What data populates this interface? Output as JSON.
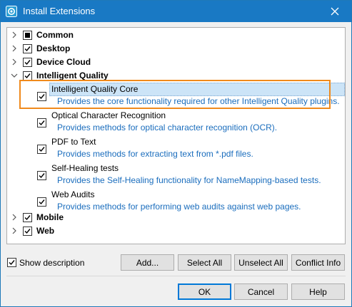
{
  "window": {
    "title": "Install Extensions",
    "app_icon": "extensions-app-icon",
    "close_icon": "close-icon"
  },
  "tree": {
    "groups": [
      {
        "label": "Common",
        "expanded": false,
        "state": "partial"
      },
      {
        "label": "Desktop",
        "expanded": false,
        "state": "checked"
      },
      {
        "label": "Device Cloud",
        "expanded": false,
        "state": "checked"
      },
      {
        "label": "Intelligent Quality",
        "expanded": true,
        "state": "checked"
      },
      {
        "label": "Mobile",
        "expanded": false,
        "state": "checked"
      },
      {
        "label": "Web",
        "expanded": false,
        "state": "checked"
      }
    ],
    "items": [
      {
        "title": "Intelligent Quality Core",
        "description": "Provides the core functionality required for other Intelligent Quality plugins.",
        "checked": true,
        "selected": true
      },
      {
        "title": "Optical Character Recognition",
        "description": "Provides methods for optical character recognition (OCR).",
        "checked": true,
        "selected": false
      },
      {
        "title": "PDF to Text",
        "description": "Provides methods for extracting text from *.pdf files.",
        "checked": true,
        "selected": false
      },
      {
        "title": "Self-Healing tests",
        "description": "Provides the Self-Healing functionality for NameMapping-based tests.",
        "checked": true,
        "selected": false
      },
      {
        "title": "Web Audits",
        "description": "Provides methods for performing web audits against web pages.",
        "checked": true,
        "selected": false
      }
    ]
  },
  "options": {
    "show_description_label": "Show description",
    "show_description_checked": true
  },
  "buttons": {
    "add": "Add...",
    "select_all": "Select All",
    "unselect_all": "Unselect All",
    "conflict_info": "Conflict Info",
    "ok": "OK",
    "cancel": "Cancel",
    "help": "Help"
  },
  "colors": {
    "titlebar": "#1979c4",
    "description_text": "#1a6dbd",
    "highlight_outline": "#f08a1c",
    "selection": "#cce4f7"
  }
}
